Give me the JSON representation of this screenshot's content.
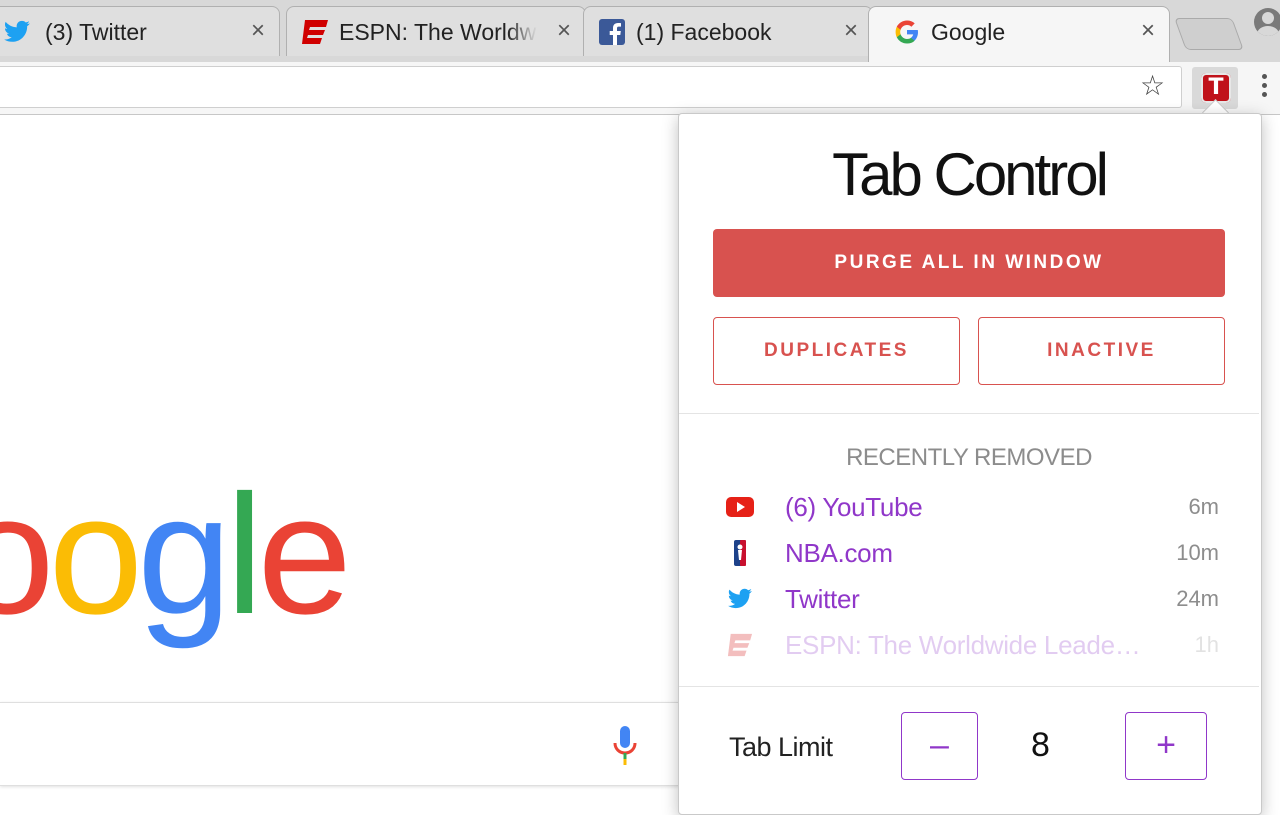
{
  "browser": {
    "tabs": [
      {
        "title": "(3) Twitter",
        "favicon": "twitter-icon",
        "active": false
      },
      {
        "title": "ESPN: The Worldwide Leader",
        "favicon": "espn-icon",
        "active": false
      },
      {
        "title": "(1) Facebook",
        "favicon": "facebook-icon",
        "active": false
      },
      {
        "title": "Google",
        "favicon": "google-icon",
        "active": true
      }
    ],
    "close_glyph": "×",
    "accent_colors": {
      "twitter": "#1da1f2",
      "espn": "#d00000",
      "facebook": "#3b5998"
    }
  },
  "page": {
    "logo_letters": [
      "o",
      "o",
      "g",
      "l",
      "e"
    ]
  },
  "popup": {
    "title": "Tab Control",
    "purge_button": "PURGE ALL IN WINDOW",
    "duplicates_button": "DUPLICATES",
    "inactive_button": "INACTIVE",
    "recent_heading": "RECENTLY REMOVED",
    "recent": [
      {
        "name": "(6) YouTube",
        "age": "6m",
        "icon": "youtube-icon"
      },
      {
        "name": "NBA.com",
        "age": "10m",
        "icon": "nba-icon"
      },
      {
        "name": "Twitter",
        "age": "24m",
        "icon": "twitter-icon"
      },
      {
        "name": "ESPN: The Worldwide Leade…",
        "age": "1h",
        "icon": "espn-icon"
      }
    ],
    "tab_limit_label": "Tab Limit",
    "tab_limit_value": "8",
    "minus": "–",
    "plus": "+",
    "colors": {
      "accent_red": "#d8524f",
      "accent_purple": "#9037c9"
    }
  },
  "extension_icon_letter": "T"
}
